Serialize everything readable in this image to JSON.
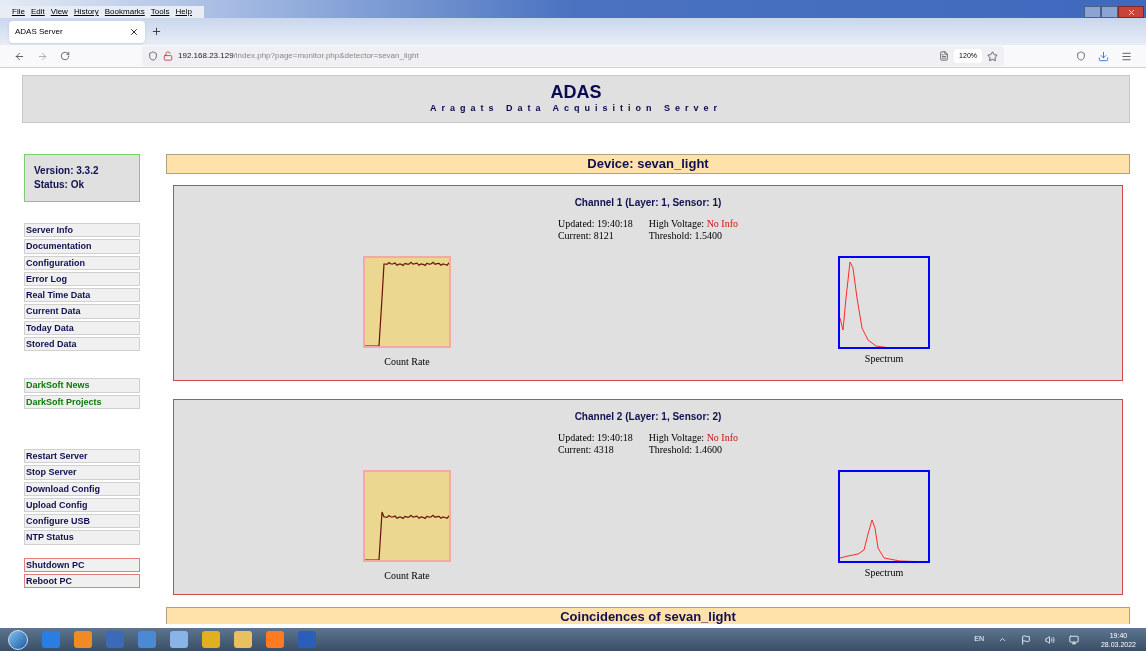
{
  "browser": {
    "menu": [
      "File",
      "Edit",
      "View",
      "History",
      "Bookmarks",
      "Tools",
      "Help"
    ],
    "tabs": [
      {
        "label": "ADAS Server",
        "selected": true
      }
    ],
    "url_host": "192.168.23.129",
    "url_path": "/index.php?page=monitor.php&detector=sevan_light",
    "zoom": "120%"
  },
  "header": {
    "title": "ADAS",
    "subtitle": "Aragats Data Acquisition Server"
  },
  "status_box": {
    "version": "Version: 3.3.2",
    "status": "Status: Ok"
  },
  "sidebar": {
    "groups": [
      [
        {
          "label": "Server Info",
          "kind": "normal"
        },
        {
          "label": "Documentation",
          "kind": "normal"
        },
        {
          "label": "Configuration",
          "kind": "normal"
        },
        {
          "label": "Error Log",
          "kind": "normal"
        },
        {
          "label": "Real Time Data",
          "kind": "normal"
        },
        {
          "label": "Current Data",
          "kind": "normal"
        },
        {
          "label": "Today Data",
          "kind": "normal"
        },
        {
          "label": "Stored Data",
          "kind": "normal"
        }
      ],
      [
        {
          "label": "DarkSoft News",
          "kind": "external"
        },
        {
          "label": "DarkSoft Projects",
          "kind": "external"
        }
      ],
      [
        {
          "label": "Restart Server",
          "kind": "normal"
        },
        {
          "label": "Stop Server",
          "kind": "normal"
        },
        {
          "label": "Download Config",
          "kind": "normal"
        },
        {
          "label": "Upload Config",
          "kind": "normal"
        },
        {
          "label": "Configure USB",
          "kind": "normal"
        },
        {
          "label": "NTP Status",
          "kind": "normal"
        }
      ],
      [
        {
          "label": "Shutdown PC",
          "kind": "danger"
        },
        {
          "label": "Reboot PC",
          "kind": "danger"
        }
      ]
    ]
  },
  "device_heading": "Device: sevan_light",
  "channels": [
    {
      "title": "Channel 1 (Layer: 1, Sensor: 1)",
      "updated": "Updated: 19:40:18",
      "current": "Current: 8121",
      "hv_label": "High Voltage:",
      "hv_value": "No Info",
      "threshold": "Threshold: 1.5400",
      "rate_caption": "Count Rate",
      "spectrum_caption": "Spectrum"
    },
    {
      "title": "Channel 2 (Layer: 1, Sensor: 2)",
      "updated": "Updated: 19:40:18",
      "current": "Current: 4318",
      "hv_label": "High Voltage:",
      "hv_value": "No Info",
      "threshold": "Threshold: 1.4600",
      "rate_caption": "Count Rate",
      "spectrum_caption": "Spectrum"
    }
  ],
  "coincidences_heading": "Coincidences of sevan_light",
  "taskbar": {
    "language": "EN",
    "time": "19:40",
    "date": "28.03.2022"
  }
}
